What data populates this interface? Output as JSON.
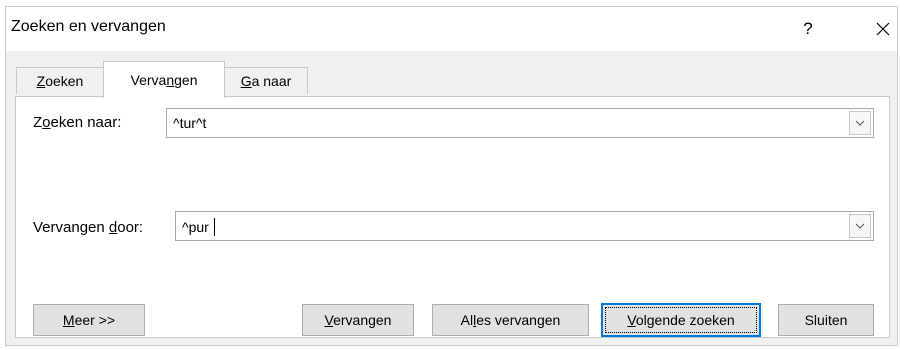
{
  "window": {
    "title": "Zoeken en vervangen",
    "help_label": "?"
  },
  "tabs": [
    {
      "pre": "",
      "mnemonic": "Z",
      "post": "oeken"
    },
    {
      "pre": "Verva",
      "mnemonic": "n",
      "post": "gen"
    },
    {
      "pre": "",
      "mnemonic": "G",
      "post": "a naar"
    }
  ],
  "find": {
    "label_pre": "Z",
    "label_mnemonic": "o",
    "label_post": "eken naar:",
    "value": "^tur^t"
  },
  "replace": {
    "label_pre": "Vervangen ",
    "label_mnemonic": "d",
    "label_post": "oor:",
    "value": "^pur "
  },
  "buttons": {
    "more": {
      "pre": "",
      "mnemonic": "M",
      "post": "eer >>"
    },
    "replace": {
      "pre": "",
      "mnemonic": "V",
      "post": "ervangen"
    },
    "replace_all": {
      "pre": "Al",
      "mnemonic": "l",
      "post": "es vervangen"
    },
    "find_next": {
      "pre": "",
      "mnemonic": "V",
      "post": "olgende zoeken"
    },
    "close": {
      "label": "Sluiten"
    }
  },
  "colors": {
    "focus_border": "#0078d7",
    "panel_bg": "#ffffff",
    "dialog_bg": "#f0f0f0"
  }
}
